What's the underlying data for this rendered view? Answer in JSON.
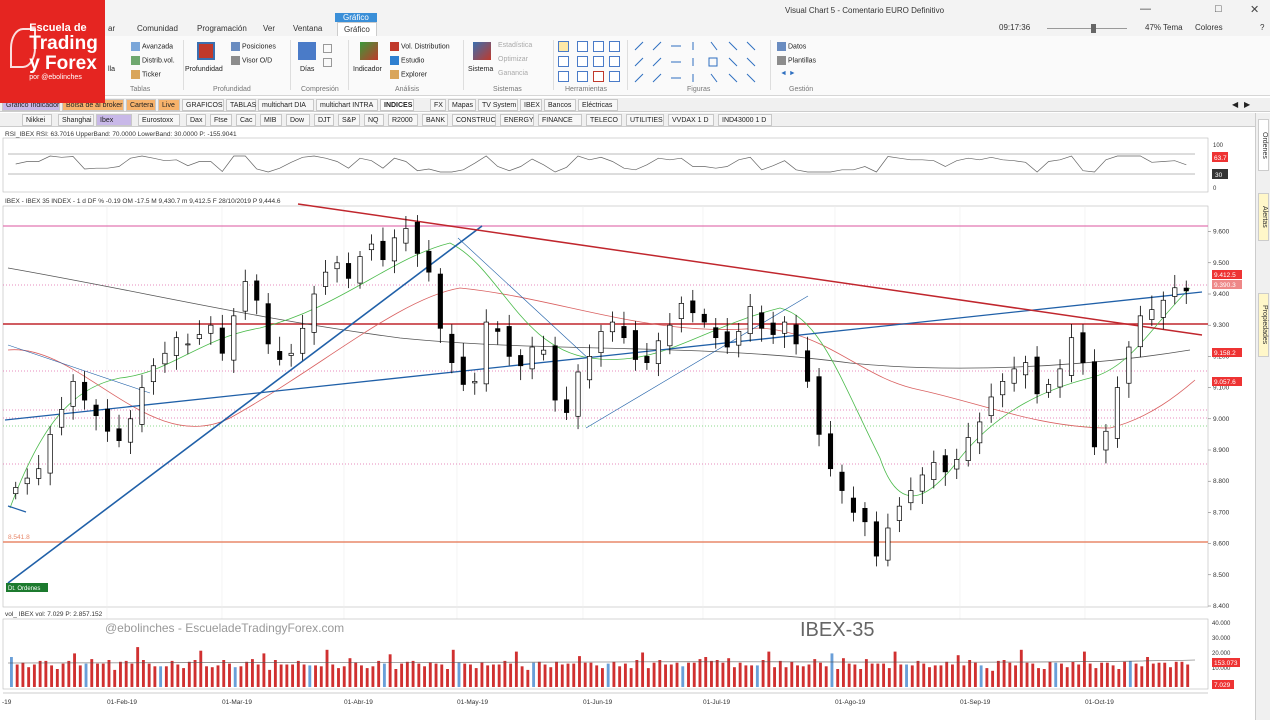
{
  "logo": {
    "line1": "Escuela de",
    "line2": "Trading",
    "line3": "y Forex",
    "line4": "por @ebolinches"
  },
  "window": {
    "title": "Visual Chart 5 - Comentario EURO Definitivo",
    "time": "09:17:36",
    "zoom": "47%",
    "tema": "Tema",
    "colores": "Colores"
  },
  "menu": {
    "items": [
      "ar",
      "Comunidad",
      "Programación",
      "Ver",
      "Ventana",
      "Gráfico"
    ],
    "context": "Gráfico"
  },
  "ribbon": {
    "avanzada": "Avanzada",
    "distrib": "Distrib.vol.",
    "ticker": "Ticker",
    "lla": "lla",
    "profundidad": "Profundidad",
    "posiciones": "Posiciones",
    "visor": "Visor O/D",
    "dias": "Días",
    "indicador": "Indicador",
    "vol_distribution": "Vol. Distribution",
    "estudio": "Estudio",
    "explorer": "Explorer",
    "sistema": "Sistema",
    "estadistica": "Estadística",
    "optimizar": "Optimizar",
    "ganancia": "Ganancia",
    "datos": "Datos",
    "plantillas": "Plantillas",
    "groups": {
      "tablas": "Tablas",
      "profundidad": "Profundidad",
      "compresion": "Compresión",
      "analisis": "Análisis",
      "sistemas": "Sistemas",
      "herramientas": "Herramientas",
      "figuras": "Figuras",
      "gestion": "Gestión"
    }
  },
  "tabs_row1": [
    "Gráfico Indicador",
    "Bolsa de al broker",
    "Cartera",
    "Live",
    "GRAFICOS",
    "TABLAS",
    "multichart DIA",
    "multichart INTRA",
    "INDICES",
    "FX",
    "Mapas",
    "TV System",
    "IBEX",
    "Bancos",
    "Eléctricas"
  ],
  "tabs_row2": [
    "Nikkei",
    "Shanghai",
    "Ibex",
    "Eurostoxx",
    "Dax",
    "Ftse",
    "Cac",
    "MIB",
    "Dow",
    "DJT",
    "S&P",
    "NQ",
    "R2000",
    "BANK",
    "CONSTRUC",
    "ENERGY",
    "FINANCE",
    "TELECO",
    "UTILITIES",
    "VVDAX 1 D",
    "IND43000 1 D"
  ],
  "rsi": {
    "header": "RSI_IBEX RSI: 63.7016 UpperBand: 70.0000 LowerBand: 30.0000 P: -155.9041",
    "val1": "63.7",
    "val2": "30",
    "scale": [
      "100",
      "0"
    ]
  },
  "price_panel": {
    "header": "IBEX - IBEX 35 INDEX - 1 d DF % -0.19 OM -17.5 M 9,430.7 m 9,412.5 F 28/10/2019 P 9,444.6",
    "y_ticks": [
      "9.600",
      "9.500",
      "9.400",
      "9.300",
      "9.200",
      "9.100",
      "9.000",
      "8.900",
      "8.800",
      "8.700",
      "8.600",
      "8.500",
      "8.400"
    ],
    "labels": {
      "last": "9.412.5",
      "l2": "9.390.3",
      "l3": "9.158.2",
      "l4": "9.057.6",
      "level": "8.541.8",
      "sell": "Dt. Ordenes"
    },
    "watermark": "@ebolinches - EscueladeTradingyForex.com",
    "symbol": "IBEX-35"
  },
  "volume_panel": {
    "header": "vol_ IBEX vol: 7.029 P: 2.857.152",
    "ticks": [
      "40.000",
      "30.000",
      "20.000",
      "10.000"
    ],
    "val1": "153.073",
    "val2": "7.029"
  },
  "x_axis": [
    "-19",
    "01-Feb-19",
    "01-Mar-19",
    "01-Abr-19",
    "01-May-19",
    "01-Jun-19",
    "01-Jul-19",
    "01-Ago-19",
    "01-Sep-19",
    "01-Oct-19"
  ],
  "sidebar": [
    "Ordenes",
    "Alertas",
    "Propiedades"
  ],
  "colors": {
    "bull": "#ffffff",
    "bear": "#000000",
    "trend_red": "#c0262d",
    "trend_blue": "#2060a8",
    "ma_green": "#4cbb4c",
    "ma_red": "#d96060",
    "ma_gray": "#555555",
    "hline_pink": "#e066a8",
    "hline_orange": "#e8886a",
    "vol_bar": "#d03030"
  },
  "chart_data": {
    "type": "candlestick",
    "symbol": "IBEX-35",
    "ylim": [
      8400,
      9650
    ],
    "x_ticks": [
      "01-Feb-19",
      "01-Mar-19",
      "01-Abr-19",
      "01-May-19",
      "01-Jun-19",
      "01-Jul-19",
      "01-Ago-19",
      "01-Sep-19",
      "01-Oct-19"
    ],
    "close_path": [
      8780,
      8810,
      8840,
      8950,
      9030,
      9120,
      9060,
      9010,
      8960,
      8930,
      9000,
      9100,
      9170,
      9210,
      9260,
      9240,
      9270,
      9300,
      9210,
      9330,
      9440,
      9380,
      9240,
      9190,
      9210,
      9290,
      9400,
      9470,
      9500,
      9450,
      9520,
      9560,
      9510,
      9580,
      9610,
      9530,
      9470,
      9290,
      9180,
      9110,
      9120,
      9310,
      9280,
      9200,
      9170,
      9230,
      9220,
      9060,
      9020,
      9150,
      9200,
      9280,
      9310,
      9260,
      9190,
      9180,
      9250,
      9300,
      9370,
      9340,
      9310,
      9260,
      9230,
      9280,
      9360,
      9290,
      9270,
      9310,
      9240,
      9120,
      8950,
      8840,
      8770,
      8700,
      8670,
      8560,
      8650,
      8720,
      8770,
      8820,
      8860,
      8830,
      8870,
      8940,
      8990,
      9070,
      9120,
      9160,
      9180,
      9080,
      9110,
      9160,
      9260,
      9180,
      8910,
      8960,
      9100,
      9230,
      9330,
      9350,
      9380,
      9420,
      9410
    ],
    "volume_path": [
      20,
      18,
      22,
      19,
      24,
      21,
      23,
      20,
      18,
      26,
      22,
      19,
      21,
      25,
      23,
      20,
      22,
      28,
      19,
      21,
      24,
      23,
      30,
      22,
      20,
      19,
      21,
      23,
      22,
      20,
      18,
      27,
      22,
      21,
      19,
      20,
      24,
      23,
      21,
      19,
      22,
      20,
      25,
      21,
      22,
      19,
      23,
      20,
      22,
      24,
      21,
      19,
      20,
      22,
      23,
      21,
      20,
      18,
      22,
      24,
      21,
      20,
      19,
      23,
      22,
      21,
      20,
      19,
      18,
      22,
      25,
      24,
      23,
      20,
      21,
      22,
      19,
      20,
      21,
      22,
      23,
      21,
      20,
      19,
      22,
      24,
      21,
      20,
      22,
      21,
      19,
      20,
      23,
      22,
      21,
      20,
      19,
      22,
      24,
      21,
      20,
      22,
      21
    ]
  }
}
